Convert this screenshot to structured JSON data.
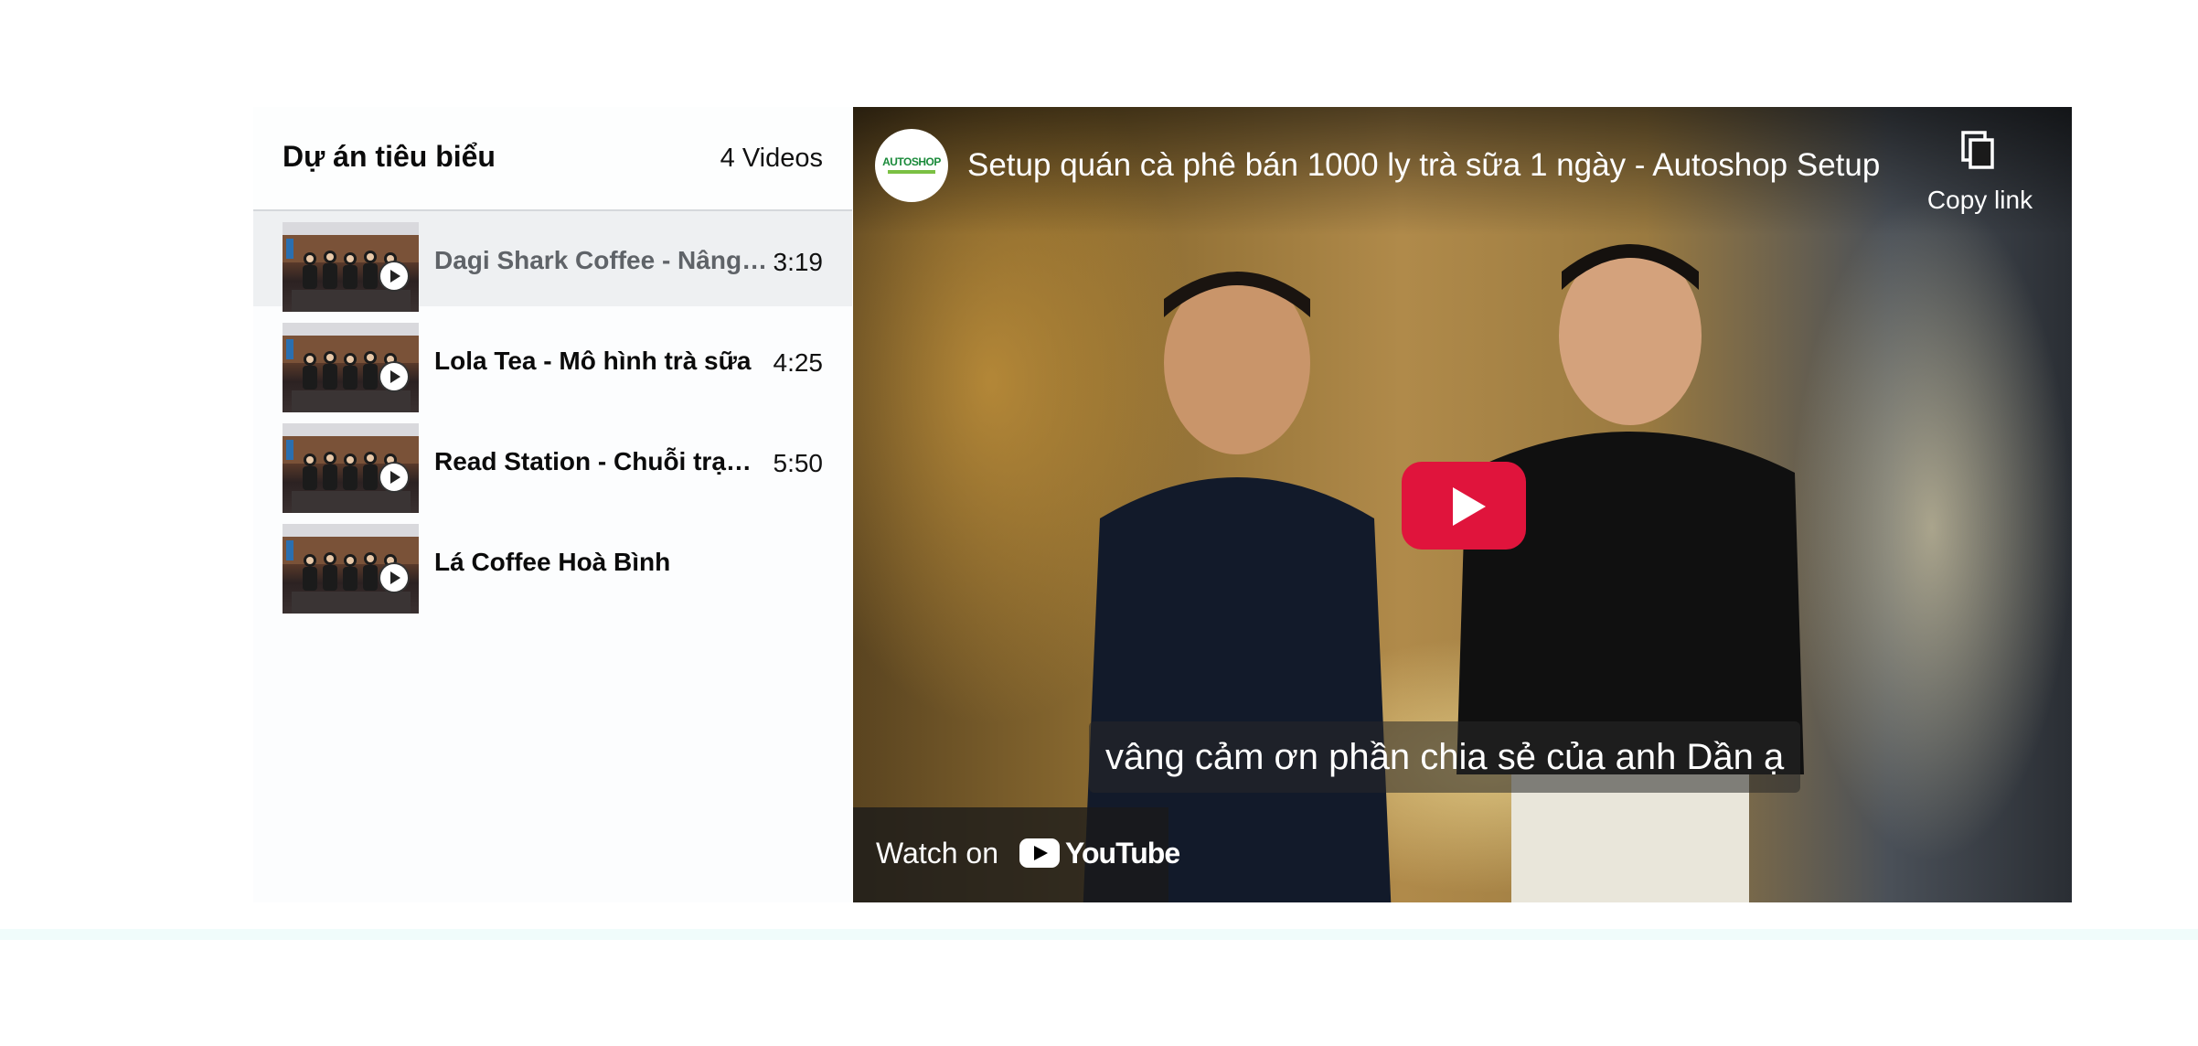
{
  "playlist": {
    "title": "Dự án tiêu biểu",
    "count": "4 Videos",
    "items": [
      {
        "title": "Dagi Shark Coffee - Nâng tầm trải nghiệm",
        "duration": "3:19",
        "active": true
      },
      {
        "title": "Lola Tea - Mô hình trà sữa",
        "duration": "4:25",
        "active": false
      },
      {
        "title": "Read Station - Chuỗi trạm đọc",
        "duration": "5:50",
        "active": false
      },
      {
        "title": "Lá Coffee Hoà Bình",
        "duration": "",
        "active": false
      }
    ]
  },
  "player": {
    "channel_logo_text": "AUTOSHOP",
    "title": "Setup quán cà phê bán 1000 ly trà sữa 1 ngày - Autoshop Setup",
    "copy_link": "Copy link",
    "caption": "vâng cảm ơn phần chia sẻ của anh Dần ạ",
    "watch_on": "Watch on",
    "youtube": "YouTube"
  },
  "colors": {
    "play_button": "#e0143c",
    "active_row": "#eef0f2",
    "bottom_band": "#f0fcfb"
  }
}
